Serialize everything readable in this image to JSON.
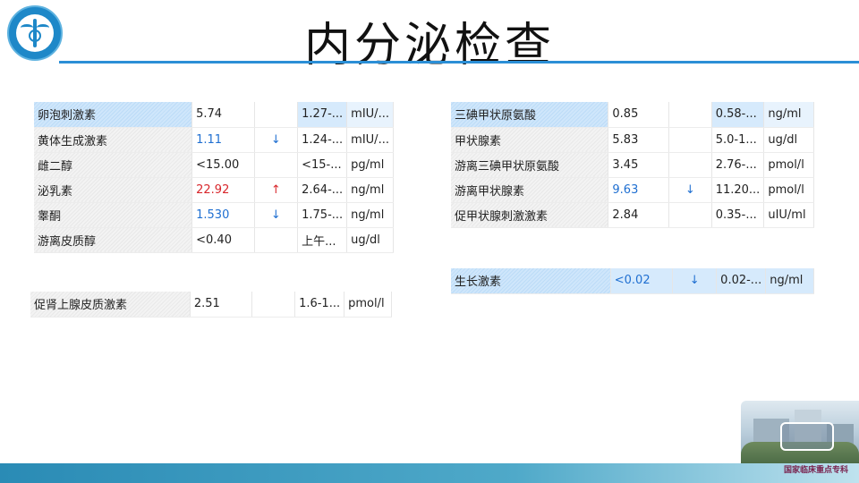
{
  "slide": {
    "title": "内分泌检查",
    "footer_label": "国家临床重点专科"
  },
  "tables": {
    "left_main": [
      {
        "name": "卵泡刺激素",
        "value": "5.74",
        "flag": "",
        "range": "1.27-...",
        "unit": "mIU/...",
        "status": "normal"
      },
      {
        "name": "黄体生成激素",
        "value": "1.11",
        "flag": "↓",
        "range": "1.24-...",
        "unit": "mIU/...",
        "status": "low"
      },
      {
        "name": "雌二醇",
        "value": "<15.00",
        "flag": "",
        "range": "<15-...",
        "unit": "pg/ml",
        "status": "normal"
      },
      {
        "name": "泌乳素",
        "value": "22.92",
        "flag": "↑",
        "range": "2.64-...",
        "unit": "ng/ml",
        "status": "high"
      },
      {
        "name": "睾酮",
        "value": "1.530",
        "flag": "↓",
        "range": "1.75-...",
        "unit": "ng/ml",
        "status": "low"
      },
      {
        "name": "游离皮质醇",
        "value": "<0.40",
        "flag": "",
        "range": "上午...",
        "unit": "ug/dl",
        "status": "normal"
      }
    ],
    "left_acth": [
      {
        "name": "促肾上腺皮质激素",
        "value": "2.51",
        "flag": "",
        "range": "1.6-1...",
        "unit": "pmol/l",
        "status": "normal"
      }
    ],
    "right_thyroid": [
      {
        "name": "三碘甲状原氨酸",
        "value": "0.85",
        "flag": "",
        "range": "0.58-...",
        "unit": "ng/ml",
        "status": "normal"
      },
      {
        "name": "甲状腺素",
        "value": "5.83",
        "flag": "",
        "range": "5.0-1...",
        "unit": "ug/dl",
        "status": "normal"
      },
      {
        "name": "游离三碘甲状原氨酸",
        "value": "3.45",
        "flag": "",
        "range": "2.76-...",
        "unit": "pmol/l",
        "status": "normal"
      },
      {
        "name": "游离甲状腺素",
        "value": "9.63",
        "flag": "↓",
        "range": "11.20...",
        "unit": "pmol/l",
        "status": "low"
      },
      {
        "name": "促甲状腺刺激激素",
        "value": "2.84",
        "flag": "",
        "range": "0.35-...",
        "unit": "uIU/ml",
        "status": "normal"
      }
    ],
    "right_gh": [
      {
        "name": "生长激素",
        "value": "<0.02",
        "flag": "↓",
        "range": "0.02-...",
        "unit": "ng/ml",
        "status": "low"
      }
    ]
  },
  "colors": {
    "title_rule": "#2b8fd6",
    "low": "#1f6fd1",
    "high": "#d8262b",
    "selected_row": "#d6eafc"
  },
  "icons": {
    "logo": "hospital-emblem-icon",
    "footer_image": "hospital-building-photo"
  }
}
